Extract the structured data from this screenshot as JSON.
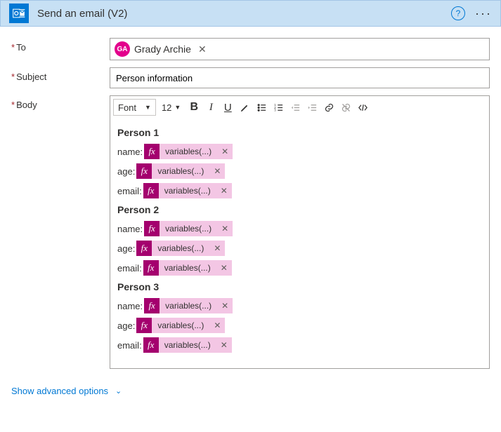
{
  "header": {
    "title": "Send an email (V2)"
  },
  "labels": {
    "to": "To",
    "subject": "Subject",
    "body": "Body",
    "required": "*"
  },
  "to": {
    "avatar_initials": "GA",
    "name": "Grady Archie"
  },
  "subject": {
    "value": "Person information"
  },
  "toolbar": {
    "font_label": "Font",
    "size_label": "12"
  },
  "body": {
    "fx_label": "variables(...)",
    "persons": [
      {
        "title": "Person 1",
        "fields": [
          "name:",
          "age:",
          "email:"
        ]
      },
      {
        "title": "Person 2",
        "fields": [
          "name:",
          "age:",
          "email:"
        ]
      },
      {
        "title": "Person 3",
        "fields": [
          "name:",
          "age:",
          "email:"
        ]
      }
    ]
  },
  "footer": {
    "advanced": "Show advanced options"
  }
}
